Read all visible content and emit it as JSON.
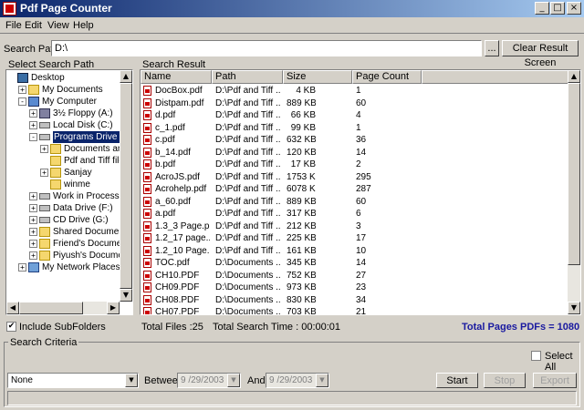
{
  "window": {
    "title": "Pdf Page Counter",
    "controls": {
      "minimize": "_",
      "maximize": "□",
      "close": "×"
    }
  },
  "menu": [
    "File",
    "Edit",
    "View",
    "Help"
  ],
  "search": {
    "label": "Search Path :",
    "value": "D:\\",
    "browse_label": "...",
    "clear_label": "Clear Result Screen"
  },
  "left_panel": {
    "title": "Select Search Path",
    "tree": [
      {
        "label": "Desktop",
        "icon": "desktop-icon",
        "indent": 0,
        "expander": ""
      },
      {
        "label": "My Documents",
        "icon": "folder-icon",
        "indent": 1,
        "expander": "+"
      },
      {
        "label": "My Computer",
        "icon": "computer-icon",
        "indent": 1,
        "expander": "-"
      },
      {
        "label": "3½ Floppy (A:)",
        "icon": "floppy-icon",
        "indent": 2,
        "expander": "+"
      },
      {
        "label": "Local Disk (C:)",
        "icon": "drive-icon",
        "indent": 2,
        "expander": "+"
      },
      {
        "label": "Programs Drive (D:)",
        "icon": "drive-icon",
        "indent": 2,
        "expander": "-",
        "selected": true
      },
      {
        "label": "Documents and Sett",
        "icon": "folder-icon",
        "indent": 3,
        "expander": "+"
      },
      {
        "label": "Pdf and Tiff files files",
        "icon": "folder-icon",
        "indent": 3,
        "expander": ""
      },
      {
        "label": "Sanjay",
        "icon": "folder-icon",
        "indent": 3,
        "expander": "+"
      },
      {
        "label": "winme",
        "icon": "folder-icon",
        "indent": 3,
        "expander": ""
      },
      {
        "label": "Work in Process (E:)",
        "icon": "drive-icon",
        "indent": 2,
        "expander": "+"
      },
      {
        "label": "Data Drive (F:)",
        "icon": "drive-icon",
        "indent": 2,
        "expander": "+"
      },
      {
        "label": "CD Drive (G:)",
        "icon": "drive-icon",
        "indent": 2,
        "expander": "+"
      },
      {
        "label": "Shared Documents",
        "icon": "folder-icon",
        "indent": 2,
        "expander": "+"
      },
      {
        "label": "Friend's Documents",
        "icon": "folder-icon",
        "indent": 2,
        "expander": "+"
      },
      {
        "label": "Piyush's Documents",
        "icon": "folder-icon",
        "indent": 2,
        "expander": "+"
      },
      {
        "label": "My Network Places",
        "icon": "network-icon",
        "indent": 1,
        "expander": "+"
      }
    ],
    "include_subfolders": {
      "label": "Include SubFolders",
      "checked": true
    }
  },
  "result": {
    "title": "Search Result",
    "columns": [
      "Name",
      "Path",
      "Size",
      "Page Count"
    ],
    "rows": [
      {
        "name": "DocBox.pdf",
        "path": "D:\\Pdf and Tiff ...",
        "size": "4 KB",
        "pages": "1"
      },
      {
        "name": "Distpam.pdf",
        "path": "D:\\Pdf and Tiff ...",
        "size": "889 KB",
        "pages": "60"
      },
      {
        "name": "d.pdf",
        "path": "D:\\Pdf and Tiff ...",
        "size": "66 KB",
        "pages": "4"
      },
      {
        "name": "c_1.pdf",
        "path": "D:\\Pdf and Tiff ...",
        "size": "99 KB",
        "pages": "1"
      },
      {
        "name": "c.pdf",
        "path": "D:\\Pdf and Tiff ...",
        "size": "632 KB",
        "pages": "36"
      },
      {
        "name": "b_14.pdf",
        "path": "D:\\Pdf and Tiff ...",
        "size": "120 KB",
        "pages": "14"
      },
      {
        "name": "b.pdf",
        "path": "D:\\Pdf and Tiff ...",
        "size": "17 KB",
        "pages": "2"
      },
      {
        "name": "AcroJS.pdf",
        "path": "D:\\Pdf and Tiff ...",
        "size": "1753 KB",
        "pages": "295"
      },
      {
        "name": "Acrohelp.pdf",
        "path": "D:\\Pdf and Tiff ...",
        "size": "6078 KB",
        "pages": "287"
      },
      {
        "name": "a_60.pdf",
        "path": "D:\\Pdf and Tiff ...",
        "size": "889 KB",
        "pages": "60"
      },
      {
        "name": "a.pdf",
        "path": "D:\\Pdf and Tiff ...",
        "size": "317 KB",
        "pages": "6"
      },
      {
        "name": "1.3_3 Page.pdf",
        "path": "D:\\Pdf and Tiff ...",
        "size": "212 KB",
        "pages": "3"
      },
      {
        "name": "1.2_17 page....",
        "path": "D:\\Pdf and Tiff ...",
        "size": "225 KB",
        "pages": "17"
      },
      {
        "name": "1.2_10 Page....",
        "path": "D:\\Pdf and Tiff ...",
        "size": "161 KB",
        "pages": "10"
      },
      {
        "name": "TOC.pdf",
        "path": "D:\\Documents ...",
        "size": "345 KB",
        "pages": "14"
      },
      {
        "name": "CH10.PDF",
        "path": "D:\\Documents ...",
        "size": "752 KB",
        "pages": "27"
      },
      {
        "name": "CH09.PDF",
        "path": "D:\\Documents ...",
        "size": "973 KB",
        "pages": "23"
      },
      {
        "name": "CH08.PDF",
        "path": "D:\\Documents ...",
        "size": "830 KB",
        "pages": "34"
      },
      {
        "name": "CH07.PDF",
        "path": "D:\\Documents ...",
        "size": "703 KB",
        "pages": "21"
      }
    ]
  },
  "status": {
    "total_files": "Total Files :25",
    "total_time": "Total Search Time : 00:00:01",
    "total_pages": "Total Pages PDFs = 1080"
  },
  "criteria": {
    "title": "Search Criteria",
    "select_all_label": "Select All",
    "filter_value": "None",
    "between_label": "Between",
    "from_date": "9 /29/2003",
    "and_label": "And",
    "to_date": "9 /29/2003",
    "start_label": "Start",
    "stop_label": "Stop",
    "export_label": "Export",
    "progress": 0
  }
}
